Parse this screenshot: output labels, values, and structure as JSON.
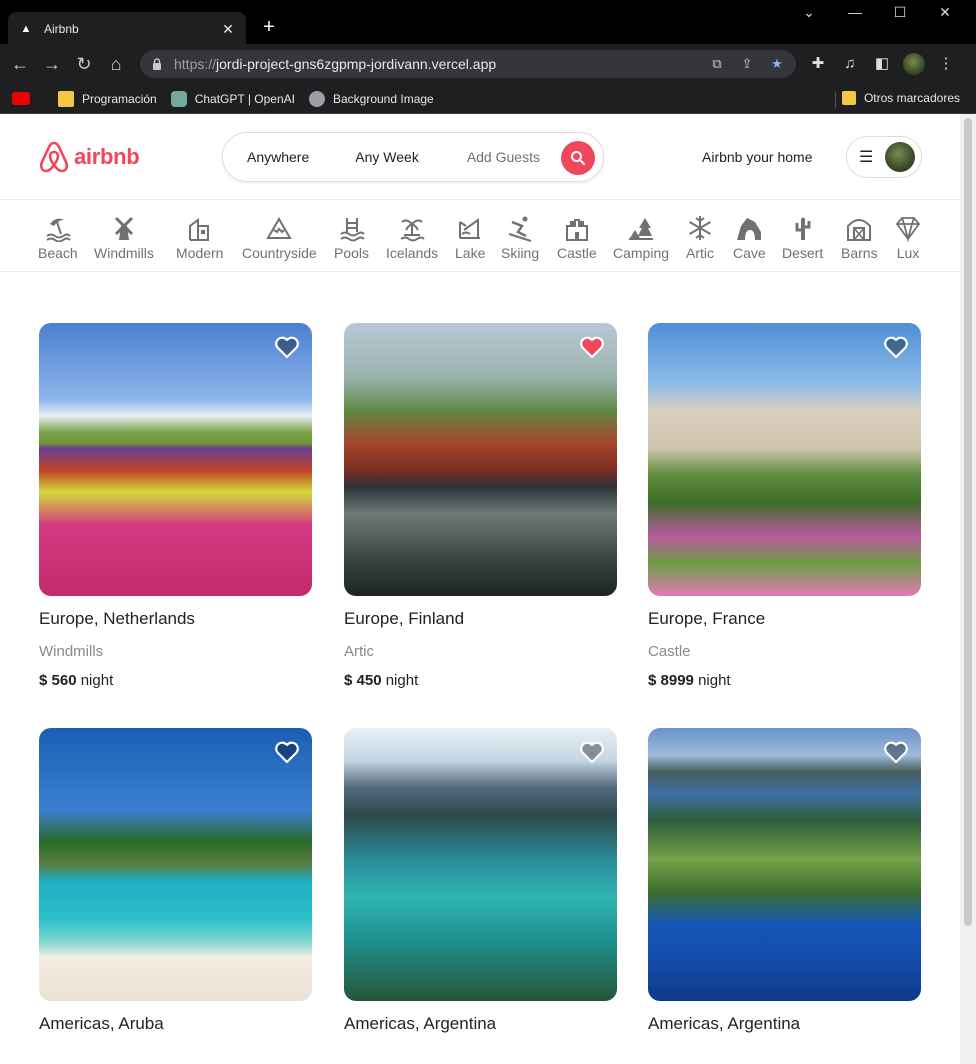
{
  "browser": {
    "tab_title": "Airbnb",
    "tab_close": "✕",
    "new_tab": "+",
    "url_scheme": "https://",
    "url_host": "jordi-project-gns6zgpmp-jordivann.vercel.app",
    "bookmarks": [
      {
        "label": "Programación",
        "icon": "folder-icon"
      },
      {
        "label": "ChatGPT | OpenAI",
        "icon": "openai-icon"
      },
      {
        "label": "Background Image",
        "icon": "globe-icon"
      }
    ],
    "other_bookmarks": "Otros marcadores"
  },
  "header": {
    "logo_text": "airbnb",
    "search": {
      "anywhere": "Anywhere",
      "any_week": "Any Week",
      "add_guests": "Add Guests"
    },
    "host_link": "Airbnb your home"
  },
  "categories": [
    {
      "label": "Beach",
      "icon": "beach-icon"
    },
    {
      "label": "Windmills",
      "icon": "windmill-icon"
    },
    {
      "label": "Modern",
      "icon": "modern-house-icon"
    },
    {
      "label": "Countryside",
      "icon": "mountain-icon"
    },
    {
      "label": "Pools",
      "icon": "pool-icon"
    },
    {
      "label": "Icelands",
      "icon": "island-icon"
    },
    {
      "label": "Lake",
      "icon": "lake-icon"
    },
    {
      "label": "Skiing",
      "icon": "skiing-icon"
    },
    {
      "label": "Castle",
      "icon": "castle-icon"
    },
    {
      "label": "Camping",
      "icon": "camping-icon"
    },
    {
      "label": "Artic",
      "icon": "snowflake-icon"
    },
    {
      "label": "Cave",
      "icon": "cave-icon"
    },
    {
      "label": "Desert",
      "icon": "cactus-icon"
    },
    {
      "label": "Barns",
      "icon": "barn-icon"
    },
    {
      "label": "Lux",
      "icon": "diamond-icon"
    }
  ],
  "listings": [
    {
      "location": "Europe, Netherlands",
      "category": "Windmills",
      "price": "$ 560",
      "unit": "night",
      "favorite": false
    },
    {
      "location": "Europe, Finland",
      "category": "Artic",
      "price": "$ 450",
      "unit": "night",
      "favorite": true
    },
    {
      "location": "Europe, France",
      "category": "Castle",
      "price": "$ 8999",
      "unit": "night",
      "favorite": false
    },
    {
      "location": "Americas, Aruba",
      "category": "",
      "price": "",
      "unit": "",
      "favorite": false
    },
    {
      "location": "Americas, Argentina",
      "category": "",
      "price": "",
      "unit": "",
      "favorite": false
    },
    {
      "location": "Americas, Argentina",
      "category": "",
      "price": "",
      "unit": "",
      "favorite": false
    }
  ],
  "colors": {
    "brand": "#f0485a",
    "favorite_heart": "#f0485a"
  }
}
